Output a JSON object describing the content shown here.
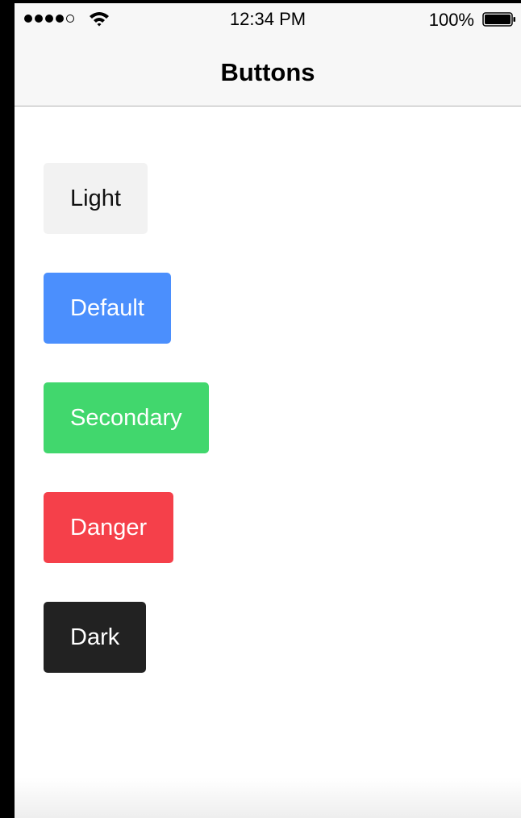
{
  "status_bar": {
    "signal_icon": "signal-dots-icon",
    "wifi_icon": "wifi-icon",
    "time": "12:34 PM",
    "battery_percent": "100%",
    "battery_icon": "battery-full-icon"
  },
  "nav": {
    "title": "Buttons"
  },
  "buttons": [
    {
      "label": "Light",
      "color": "#f2f2f2"
    },
    {
      "label": "Default",
      "color": "#4b8ffd"
    },
    {
      "label": "Secondary",
      "color": "#41d76d"
    },
    {
      "label": "Danger",
      "color": "#f5404a"
    },
    {
      "label": "Dark",
      "color": "#222222"
    }
  ]
}
